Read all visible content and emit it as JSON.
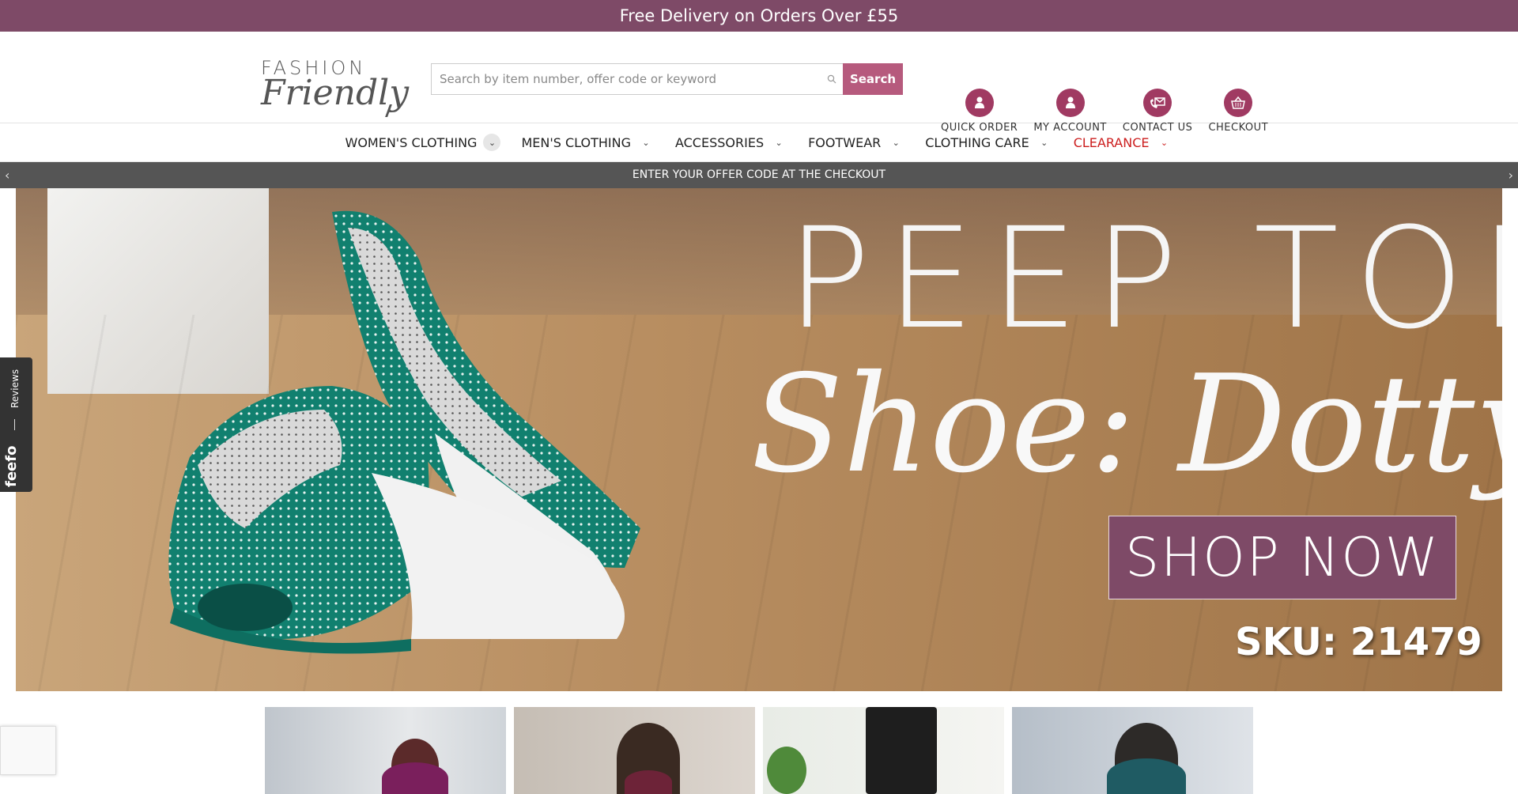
{
  "topbar": {
    "text": "Free Delivery on Orders Over £55"
  },
  "logo": {
    "line1": "FASHION",
    "line2": "Friendly"
  },
  "search": {
    "placeholder": "Search by item number, offer code or keyword",
    "button": "Search"
  },
  "header_links": [
    {
      "label": "QUICK ORDER",
      "icon": "person-icon"
    },
    {
      "label": "MY ACCOUNT",
      "icon": "account-icon"
    },
    {
      "label": "CONTACT US",
      "icon": "phone-mail-icon"
    },
    {
      "label": "CHECKOUT",
      "icon": "basket-icon"
    }
  ],
  "nav": [
    {
      "label": "WOMEN'S CLOTHING"
    },
    {
      "label": "MEN'S CLOTHING"
    },
    {
      "label": "ACCESSORIES"
    },
    {
      "label": "FOOTWEAR"
    },
    {
      "label": "CLOTHING CARE"
    },
    {
      "label": "CLEARANCE"
    }
  ],
  "offerbar": {
    "text": "ENTER YOUR OFFER CODE AT THE CHECKOUT"
  },
  "hero": {
    "title1": "PEEP TOE",
    "title2": "Shoe: Dotty",
    "cta": "SHOP NOW",
    "sku": "SKU: 21479"
  },
  "reviews_tab": {
    "label": "Reviews",
    "brand": "feefo"
  },
  "colors": {
    "brand": "#7e4a67",
    "accent": "#a03a62",
    "search_btn": "#b65a7d",
    "clearance": "#cc1f1f"
  }
}
